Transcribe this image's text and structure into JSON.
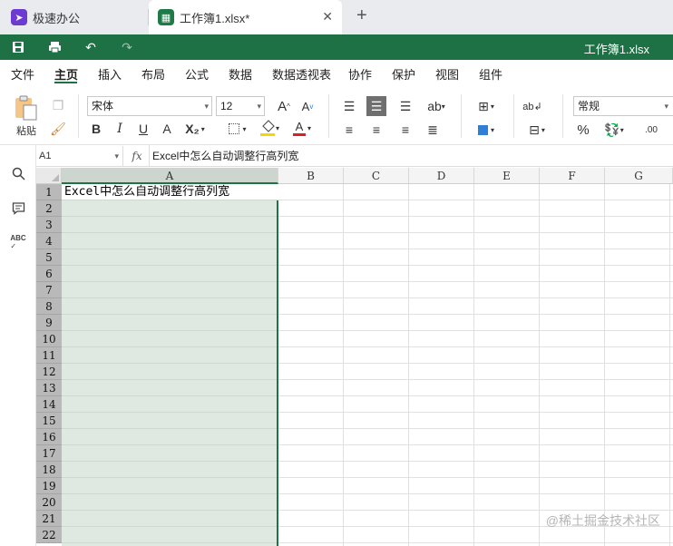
{
  "tabs": [
    {
      "label": "极速办公",
      "icon": "rocket-icon"
    },
    {
      "label": "工作簿1.xlsx*",
      "icon": "spreadsheet-icon"
    }
  ],
  "new_tab_label": "+",
  "close_glyph": "✕",
  "title_bar": {
    "doc_title": "工作簿1.xlsx",
    "color": "#1e7145"
  },
  "menu": {
    "items": [
      "文件",
      "主页",
      "插入",
      "布局",
      "公式",
      "数据",
      "数据透视表",
      "协作",
      "保护",
      "视图",
      "组件"
    ],
    "active": "主页"
  },
  "ribbon": {
    "paste_label": "粘贴",
    "font_name": "宋体",
    "font_size": "12",
    "number_format": "常规",
    "bold": "B",
    "italic": "I",
    "underline": "U",
    "strike": "A",
    "subscript": "X₂",
    "font_color": "A",
    "grow": "A",
    "shrink": "A",
    "percent": "%",
    "decimals": ".00"
  },
  "formula_bar": {
    "cell_ref": "A1",
    "fx": "fx",
    "content": "Excel中怎么自动调整行高列宽"
  },
  "grid": {
    "columns": [
      "A",
      "B",
      "C",
      "D",
      "E",
      "F",
      "G"
    ],
    "selected_column": "A",
    "rows": [
      "1",
      "2",
      "3",
      "4",
      "5",
      "6",
      "7",
      "8",
      "9",
      "10",
      "11",
      "12",
      "13",
      "14",
      "15",
      "16",
      "17",
      "18",
      "19",
      "20",
      "21",
      "22"
    ],
    "a1_value": "Excel中怎么自动调整行高列宽"
  },
  "watermark": "@稀土掘金技术社区"
}
